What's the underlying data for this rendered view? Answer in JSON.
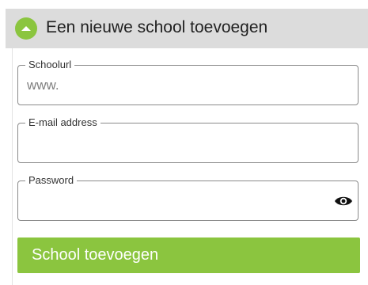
{
  "header": {
    "title": "Een nieuwe school toevoegen",
    "icon": "chevron-up-icon",
    "accent": "#8bc53f",
    "background": "#dcdcdc"
  },
  "form": {
    "school_url": {
      "label": "Schoolurl",
      "value": "www."
    },
    "email": {
      "label": "E-mail address",
      "value": ""
    },
    "password": {
      "label": "Password",
      "value": "",
      "toggle_icon": "eye-icon"
    },
    "submit_label": "School toevoegen"
  }
}
